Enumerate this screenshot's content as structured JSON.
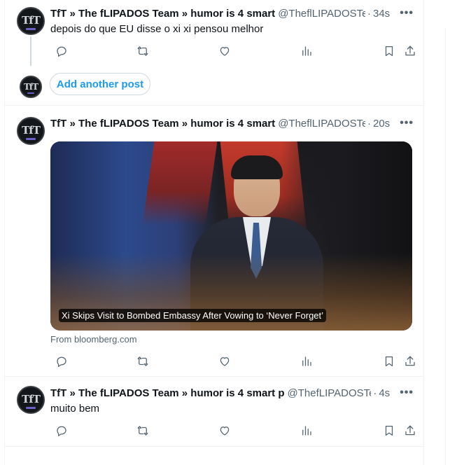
{
  "posts": [
    {
      "author_name": "TfT » The fLIPADOS Team » humor is 4 smart",
      "handle": "@TheflLIPADOSTe",
      "handle_display": "@TheflLIPADOSTe",
      "time": "34s",
      "text": "depois do que EU disse o xi xi pensou melhor",
      "avatar_logo": "TfT"
    },
    {
      "author_name": "TfT » The fLIPADOS Team » humor is 4 smart",
      "handle_display": "@TheflLIPADOSTe",
      "time": "20s",
      "avatar_logo": "TfT",
      "card": {
        "caption": "Xi Skips Visit to Bombed Embassy After Vowing to ‘Never Forget’",
        "source": "From bloomberg.com"
      }
    },
    {
      "author_name": "TfT » The fLIPADOS Team » humor is 4 smart p",
      "handle_display": "@ThefLIPADOSTe",
      "time": "4s",
      "text": "muito bem",
      "avatar_logo": "TfT"
    }
  ],
  "composer": {
    "add_another_post_label": "Add another post",
    "avatar_logo": "TfT"
  },
  "separator": "·",
  "more_glyph": "•••",
  "icons": [
    "reply-icon",
    "repost-icon",
    "like-icon",
    "views-icon",
    "bookmark-icon",
    "share-icon",
    "more-icon"
  ],
  "colors": {
    "accent": "#1d9bf0",
    "text_primary": "#0f1419",
    "text_secondary": "#536471",
    "border": "#eff3f4"
  }
}
